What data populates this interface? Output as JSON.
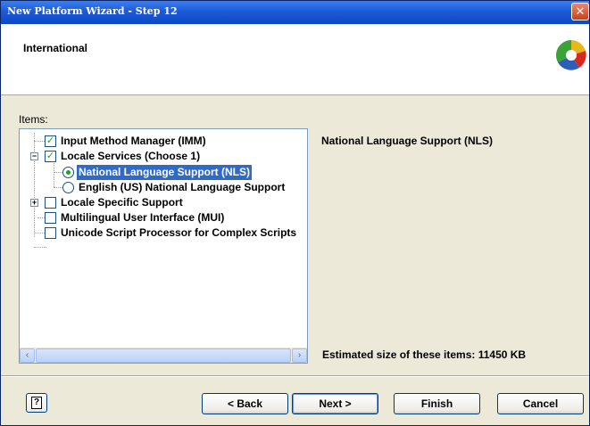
{
  "window": {
    "title": "New Platform Wizard - Step 12",
    "close_glyph": "✕"
  },
  "header": {
    "title": "International",
    "logo_icon": "wizard-logo-icon"
  },
  "items_label": "Items:",
  "tree": {
    "items": [
      {
        "label": "Input Method Manager (IMM)",
        "control": "checkbox",
        "checked": true
      },
      {
        "label": "Locale Services (Choose 1)",
        "control": "checkbox",
        "checked": true,
        "expanded": true
      },
      {
        "label": "National Language Support (NLS)",
        "control": "radio",
        "checked": true,
        "selected": true
      },
      {
        "label": "English (US) National Language Support",
        "control": "radio",
        "checked": false
      },
      {
        "label": "Locale Specific Support",
        "control": "checkbox",
        "checked": false,
        "expanded": false
      },
      {
        "label": "Multilingual User Interface (MUI)",
        "control": "checkbox",
        "checked": false
      },
      {
        "label": "Unicode Script Processor for Complex Scripts",
        "control": "checkbox",
        "checked": false
      }
    ],
    "scroll_left_glyph": "‹",
    "scroll_right_glyph": "›"
  },
  "description": "National Language Support (NLS)",
  "estimated_size": "Estimated size of these items: 11450 KB",
  "buttons": {
    "help_glyph": "?",
    "back": "< Back",
    "next": "Next >",
    "finish": "Finish",
    "cancel": "Cancel"
  },
  "colors": {
    "selection": "#316ac5",
    "titlebar": "#0b48c8",
    "check": "#21a121"
  }
}
